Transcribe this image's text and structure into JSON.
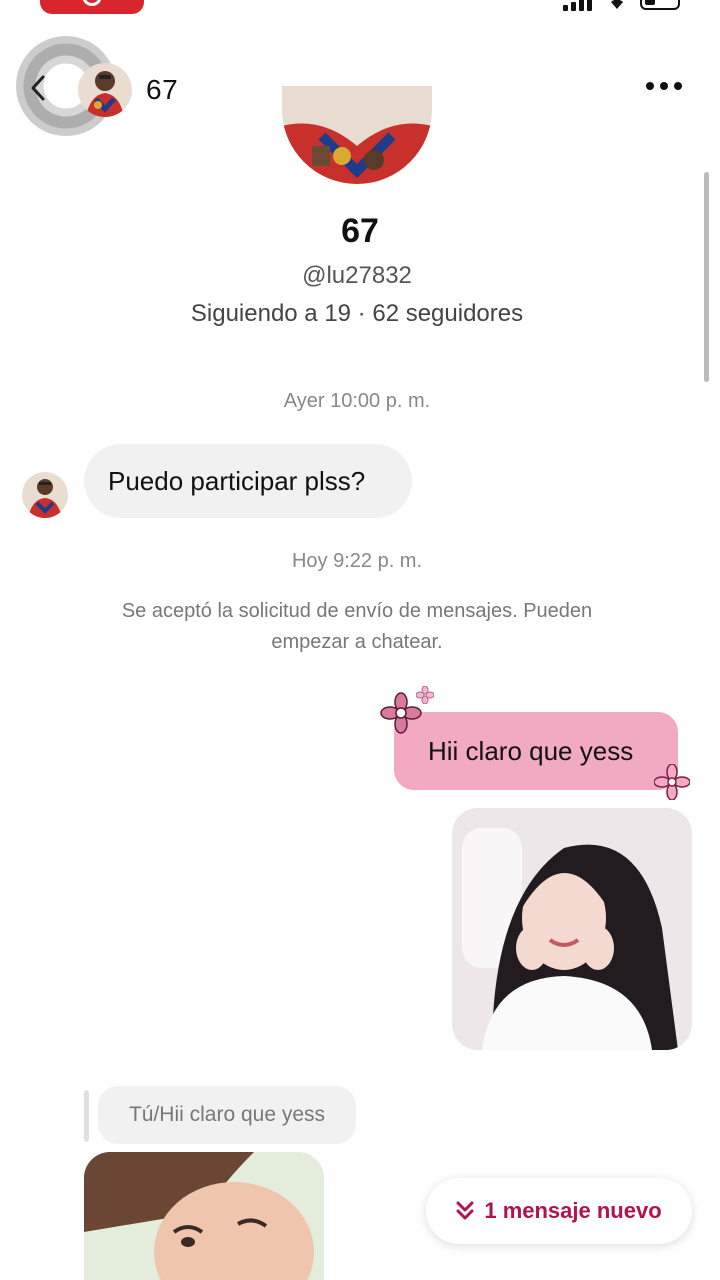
{
  "header": {
    "title": "67"
  },
  "profile": {
    "name": "67",
    "handle": "@lu27832",
    "stats": "Siguiendo a 19 · 62 seguidores"
  },
  "messages": {
    "timestamp_1": "Ayer 10:00 p. m.",
    "incoming_1": "Puedo participar plss?",
    "timestamp_2": "Hoy 9:22 p. m.",
    "system_notice": "Se aceptó la solicitud de envío de mensajes. Pueden empezar a chatear.",
    "outgoing_1": "Hii claro que yess",
    "reply_quote": "Tú/Hii claro que yess"
  },
  "new_message_pill": {
    "label": "1 mensaje nuevo"
  },
  "colors": {
    "accent": "#b3124f",
    "outgoing_bubble": "#f2a9c2",
    "incoming_bubble": "#f1f1f1",
    "status_pill": "#d9262e"
  },
  "icons": [
    "record-icon",
    "signal-icon",
    "wifi-icon",
    "battery-icon",
    "back-chevron-icon",
    "more-dots-icon",
    "flower-sticker-icon",
    "double-chevron-down-icon"
  ]
}
